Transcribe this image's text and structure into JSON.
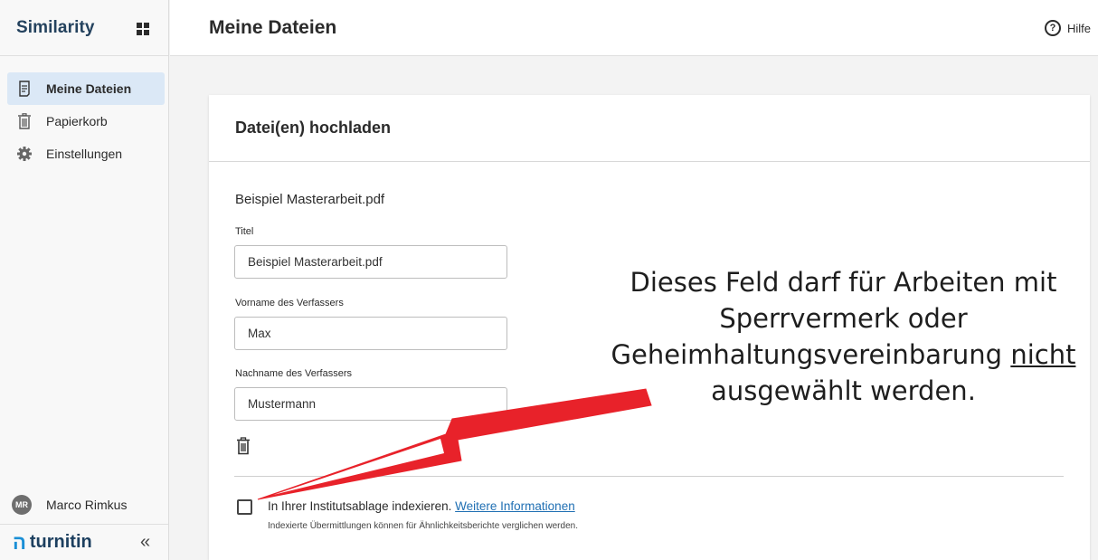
{
  "sidebar": {
    "brand": "Similarity",
    "items": [
      {
        "label": "Meine Dateien",
        "icon": "document-icon",
        "active": true
      },
      {
        "label": "Papierkorb",
        "icon": "trash-icon",
        "active": false
      },
      {
        "label": "Einstellungen",
        "icon": "gear-icon",
        "active": false
      }
    ],
    "user": {
      "initials": "MR",
      "name": "Marco Rimkus"
    },
    "footer": {
      "logo": "turnitin",
      "logo_mark": "ה",
      "collapse_glyph": "«"
    }
  },
  "header": {
    "title": "Meine Dateien",
    "help_label": "Hilfe",
    "help_glyph": "?"
  },
  "upload": {
    "title": "Datei(en) hochladen",
    "file_name": "Beispiel Masterarbeit.pdf",
    "fields": [
      {
        "label": "Titel",
        "value": "Beispiel Masterarbeit.pdf"
      },
      {
        "label": "Vorname des Verfassers",
        "value": "Max"
      },
      {
        "label": "Nachname des Verfassers",
        "value": "Mustermann"
      }
    ],
    "index": {
      "checked": false,
      "text": "In Ihrer Institutsablage indexieren.",
      "link": "Weitere Informationen",
      "sub": "Indexierte Übermittlungen können für Ähnlichkeitsberichte verglichen werden."
    }
  },
  "annotation": {
    "line1": "Dieses Feld darf für Arbeiten mit",
    "line2": "Sperrvermerk oder",
    "line3_a": "Geheimhaltungsvereinbarung",
    "line3_b": "nicht",
    "line4": "ausgewählt werden.",
    "arrow_color": "#e8222a"
  },
  "colors": {
    "accent": "#1f6fb3",
    "brand": "#24425e",
    "active_nav": "#dbe8f6"
  }
}
